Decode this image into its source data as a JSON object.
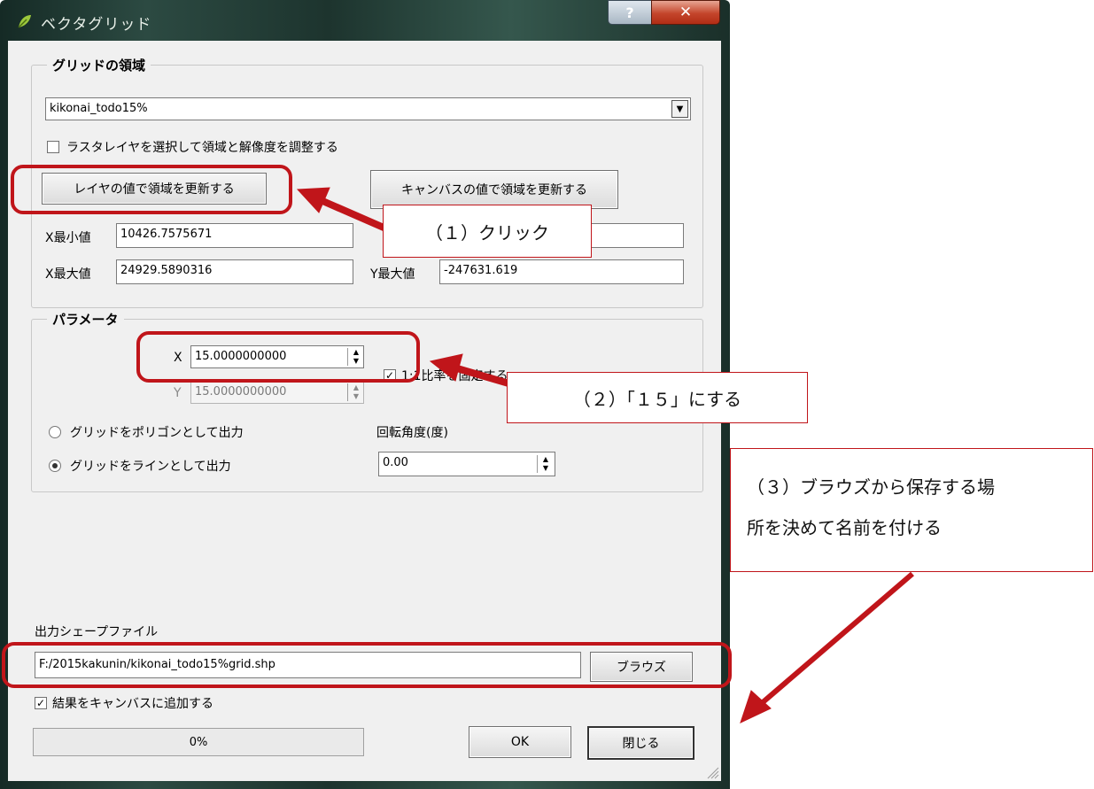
{
  "window": {
    "title": "ベクタグリッド"
  },
  "extent_group": {
    "title": "グリッドの領域",
    "layer_select": "kikonai_todo15%",
    "raster_checkbox_label": "ラスタレイヤを選択して領域と解像度を調整する",
    "raster_checked": false,
    "update_from_layer_button": "レイヤの値で領域を更新する",
    "update_from_canvas_button": "キャンバスの値で領域を更新する",
    "xmin_label": "X最小値",
    "xmin_value": "10426.7575671",
    "xmax_label": "X最大値",
    "xmax_value": "24929.5890316",
    "ymax_label": "Y最大値",
    "ymax_value": "-247631.619"
  },
  "params_group": {
    "title": "パラメータ",
    "x_label": "X",
    "x_value": "15.0000000000",
    "y_label": "Y",
    "y_value": "15.0000000000",
    "ratio_checkbox_label": "1:1比率を固定する",
    "ratio_checked": true,
    "polygon_radio_label": "グリッドをポリゴンとして出力",
    "line_radio_label": "グリッドをラインとして出力",
    "selected_output": "line",
    "rotation_label": "回転角度(度)",
    "rotation_value": "0.00"
  },
  "output": {
    "label": "出力シェープファイル",
    "path": "F:/2015kakunin/kikonai_todo15%grid.shp",
    "browse_button": "ブラウズ",
    "add_to_canvas_label": "結果をキャンバスに追加する",
    "add_to_canvas_checked": true
  },
  "footer": {
    "progress_text": "0%",
    "progress": 0,
    "ok_button": "OK",
    "close_button": "閉じる"
  },
  "annotations": {
    "step1": "（１）クリック",
    "step2": "（２）「１５」にする",
    "step3_line1": "（３）ブラウズから保存する場",
    "step3_line2": "所を決めて名前を付ける",
    "color": "#c0151a"
  }
}
